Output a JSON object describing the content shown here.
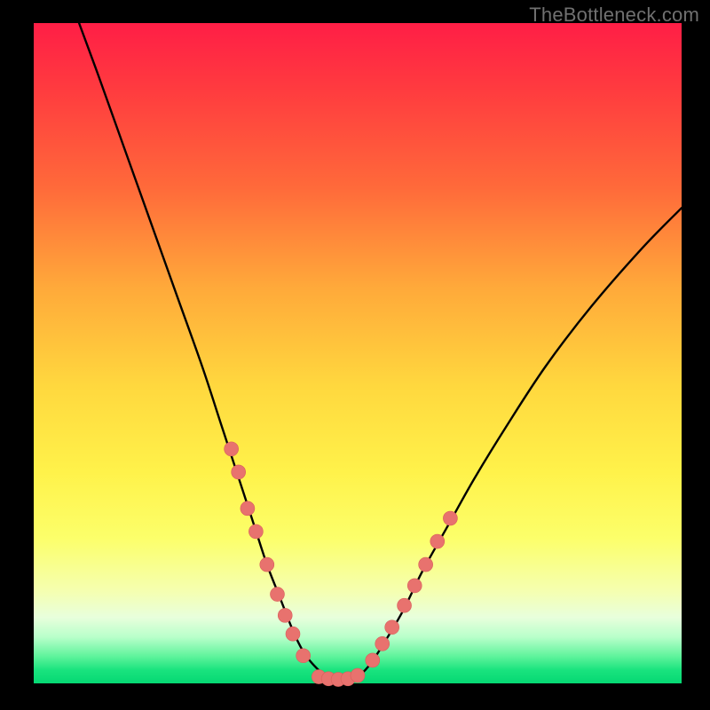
{
  "watermark": "TheBottleneck.com",
  "chart_data": {
    "type": "line",
    "title": "",
    "xlabel": "",
    "ylabel": "",
    "xlim": [
      0,
      100
    ],
    "ylim": [
      0,
      100
    ],
    "grid": false,
    "legend": false,
    "background_gradient": {
      "top": "#ff1e46",
      "mid": "#ffe23e",
      "bottom": "#05d873"
    },
    "series": [
      {
        "name": "bottleneck-curve",
        "type": "line",
        "color": "#000000",
        "x": [
          7,
          10,
          14,
          18,
          22,
          26,
          29,
          32,
          34,
          36,
          38,
          40,
          41.5,
          43,
          45,
          47,
          49,
          50.5,
          52,
          54,
          57,
          60,
          64,
          68,
          73,
          79,
          86,
          94,
          100
        ],
        "y": [
          100,
          92,
          81,
          70,
          59,
          48,
          39,
          30,
          24,
          18,
          13,
          8,
          5,
          3,
          1.2,
          0.6,
          0.6,
          1.4,
          3,
          6,
          11,
          17,
          24,
          31,
          39,
          48,
          57,
          66,
          72
        ]
      },
      {
        "name": "markers-left",
        "type": "scatter",
        "color": "#e8726e",
        "x": [
          30.5,
          31.6,
          33.0,
          34.3,
          36.0,
          37.6,
          38.8,
          40.0,
          41.6
        ],
        "y": [
          35.5,
          32.0,
          26.5,
          23.0,
          18.0,
          13.5,
          10.3,
          7.5,
          4.2
        ]
      },
      {
        "name": "markers-bottom",
        "type": "scatter",
        "color": "#e8726e",
        "x": [
          44.0,
          45.5,
          47.0,
          48.5,
          50.0
        ],
        "y": [
          1.0,
          0.7,
          0.6,
          0.7,
          1.2
        ]
      },
      {
        "name": "markers-right",
        "type": "scatter",
        "color": "#e8726e",
        "x": [
          52.3,
          53.8,
          55.3,
          57.2,
          58.8,
          60.5,
          62.3,
          64.3
        ],
        "y": [
          3.5,
          6.0,
          8.5,
          11.8,
          14.8,
          18.0,
          21.5,
          25.0
        ]
      }
    ]
  }
}
